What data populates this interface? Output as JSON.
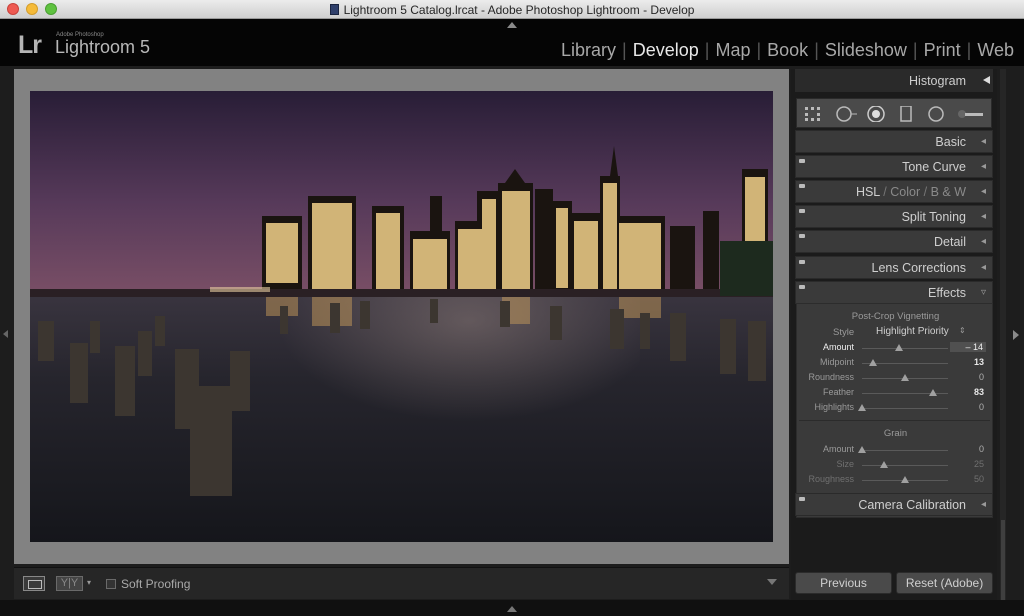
{
  "window": {
    "title": "Lightroom 5 Catalog.lrcat - Adobe Photoshop Lightroom - Develop"
  },
  "brand": {
    "mark": "Lr",
    "vendor": "Adobe Photoshop",
    "product": "Lightroom 5"
  },
  "modules": [
    "Library",
    "Develop",
    "Map",
    "Book",
    "Slideshow",
    "Print",
    "Web"
  ],
  "active_module": "Develop",
  "toolbar": {
    "soft_proofing_label": "Soft Proofing",
    "before_after_label": "Y|Y"
  },
  "panels": {
    "histogram": "Histogram",
    "basic": "Basic",
    "tone_curve": "Tone Curve",
    "hsl": {
      "hsl": "HSL",
      "sep1": "/",
      "color": "Color",
      "sep2": "/",
      "bw": "B & W"
    },
    "split_toning": "Split Toning",
    "detail": "Detail",
    "lens_corrections": "Lens Corrections",
    "effects": "Effects",
    "camera_calibration": "Camera Calibration"
  },
  "effects": {
    "vignetting_title": "Post-Crop Vignetting",
    "style_label": "Style",
    "style_value": "Highlight Priority",
    "vignette_sliders": [
      {
        "label": "Amount",
        "value": "– 14",
        "level": 0.43
      },
      {
        "label": "Midpoint",
        "value": "13",
        "level": 0.13
      },
      {
        "label": "Roundness",
        "value": "0",
        "level": 0.5
      },
      {
        "label": "Feather",
        "value": "83",
        "level": 0.83
      },
      {
        "label": "Highlights",
        "value": "0",
        "level": 0.0
      }
    ],
    "grain_title": "Grain",
    "grain_sliders": [
      {
        "label": "Amount",
        "value": "0",
        "level": 0.0
      },
      {
        "label": "Size",
        "value": "25",
        "level": 0.25
      },
      {
        "label": "Roughness",
        "value": "50",
        "level": 0.5
      }
    ]
  },
  "buttons": {
    "previous": "Previous",
    "reset": "Reset (Adobe)"
  },
  "colors": {
    "sky_top": "#2a1f3a",
    "sky_mid": "#6b3f5e",
    "water": "#1c1d24",
    "light": "#f2d08a"
  }
}
